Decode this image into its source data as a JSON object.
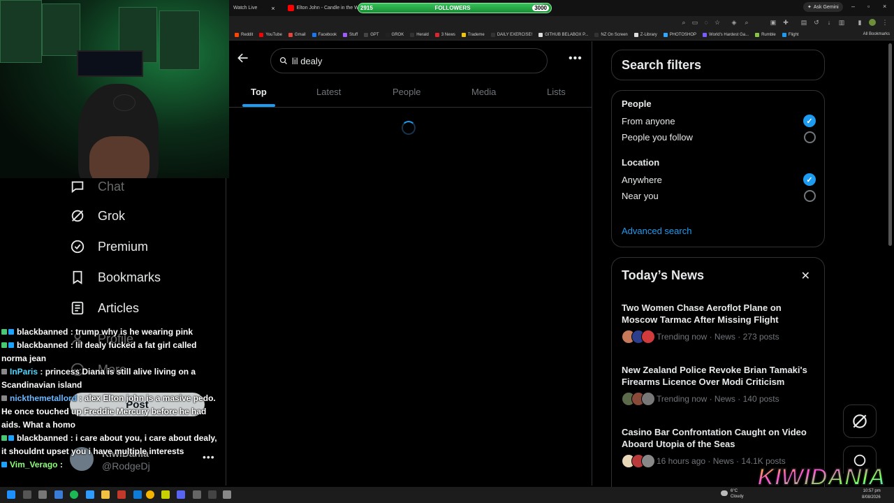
{
  "browser": {
    "tabs": [
      {
        "label": "Watch Live",
        "icon_color": "#9146ff"
      },
      {
        "label": "Elton John - Candle in the Win",
        "icon_color": "#ff0000"
      },
      {
        "label": "X",
        "icon_color": "#000000"
      }
    ],
    "followers_widget": {
      "label": "FOLLOWERS",
      "current": "2915",
      "goal": "3000",
      "progress": 0.972
    },
    "ask_gemini": "Ask Gemini",
    "bookmarks": [
      {
        "label": "Reddit",
        "color": "#ff4500"
      },
      {
        "label": "YouTube",
        "color": "#ff0000"
      },
      {
        "label": "Gmail",
        "color": "#ea4335"
      },
      {
        "label": "Facebook",
        "color": "#1877f2"
      },
      {
        "label": "Stuff",
        "color": "#a259ff"
      },
      {
        "label": "GPT",
        "color": "#444444"
      },
      {
        "label": "GROK",
        "color": "#222222"
      },
      {
        "label": "Herald",
        "color": "#333333"
      },
      {
        "label": "3 News",
        "color": "#e0242b"
      },
      {
        "label": "Trademe",
        "color": "#f5c400"
      },
      {
        "label": "DAILY EXERCISE!",
        "color": "#333333"
      },
      {
        "label": "GITHUB BELABOX P...",
        "color": "#dddddd"
      },
      {
        "label": "NZ On Screen",
        "color": "#333333"
      },
      {
        "label": "Z-Library",
        "color": "#dddddd"
      },
      {
        "label": "PHOTOSHOP",
        "color": "#31a8ff"
      },
      {
        "label": "World's Hardest Ga...",
        "color": "#7a5cff"
      },
      {
        "label": "Rumble",
        "color": "#85c742"
      },
      {
        "label": "Flight",
        "color": "#1d9bf0"
      }
    ],
    "all_bookmarks": "All Bookmarks"
  },
  "sidebar": {
    "items": [
      {
        "label": "Chat",
        "icon": "chat-icon"
      },
      {
        "label": "Grok",
        "icon": "grok-icon"
      },
      {
        "label": "Premium",
        "icon": "premium-icon"
      },
      {
        "label": "Bookmarks",
        "icon": "bookmark-icon"
      },
      {
        "label": "Articles",
        "icon": "articles-icon"
      },
      {
        "label": "Profile",
        "icon": "profile-icon"
      },
      {
        "label": "More",
        "icon": "more-icon"
      }
    ],
    "post_button": "Post",
    "account": {
      "name": "KiwiDania",
      "handle": "@RodgeDj",
      "more": "•••"
    }
  },
  "chat": [
    {
      "user": "blackbanned",
      "message": " : trump why is he wearing pink",
      "color": "white"
    },
    {
      "user": "blackbanned",
      "message": " : lil dealy fucked a fat girl called norma jean",
      "color": "white"
    },
    {
      "user": "InParis",
      "message": " : princess Diana is still alive living on a Scandinavian island",
      "color": "cyan"
    },
    {
      "user": "nickthemetallord",
      "message": " : alex Elton john is a masive pedo. He once touched up Freddie Mercury before he had aids. What a homo",
      "color": "blue"
    },
    {
      "user": "blackbanned",
      "message": " : i care about you, i care about dealy, it shouldnt upset you i have multiple interests",
      "color": "white"
    },
    {
      "user": "Vim_Verago",
      "message": " : ",
      "color": "green"
    }
  ],
  "search": {
    "query": "lil dealy",
    "tabs": [
      "Top",
      "Latest",
      "People",
      "Media",
      "Lists"
    ],
    "active_tab": "Top"
  },
  "filters": {
    "title": "Search filters",
    "people_heading": "People",
    "people_options": [
      {
        "label": "From anyone",
        "selected": true
      },
      {
        "label": "People you follow",
        "selected": false
      }
    ],
    "location_heading": "Location",
    "location_options": [
      {
        "label": "Anywhere",
        "selected": true
      },
      {
        "label": "Near you",
        "selected": false
      }
    ],
    "advanced": "Advanced search"
  },
  "news": {
    "title": "Today’s News",
    "items": [
      {
        "headline": "Two Women Chase Aeroflot Plane on Moscow Tarmac After Missing Flight",
        "meta": "Trending now · News · 273 posts"
      },
      {
        "headline": "New Zealand Police Revoke Brian Tamaki's Firearms Licence Over Modi Criticism",
        "meta": "Trending now · News · 140 posts"
      },
      {
        "headline": "Casino Bar Confrontation Caught on Video Aboard Utopia of the Seas",
        "meta": "16 hours ago · News · 14.1K posts"
      }
    ]
  },
  "overlay_logo": "KIWIDANIA",
  "taskbar": {
    "weather_temp": "6°C",
    "weather_desc": "Cloudy",
    "time": "10:57 pm",
    "date": "8/08/2026"
  },
  "colors": {
    "accent": "#1d9bf0",
    "background": "#000000",
    "border": "#2f3336",
    "muted": "#71767b"
  }
}
